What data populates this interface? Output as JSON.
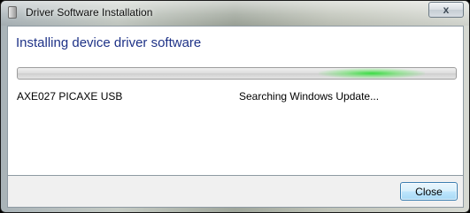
{
  "window": {
    "title": "Driver Software Installation",
    "close_glyph": "x"
  },
  "main": {
    "heading": "Installing device driver software",
    "progress": {
      "style": "indeterminate",
      "accent_color": "#2fd43a"
    },
    "device": {
      "name": "AXE027 PICAXE USB",
      "status": "Searching Windows Update..."
    }
  },
  "footer": {
    "close_label": "Close"
  },
  "icons": {
    "app": "driver-icon",
    "close": "close-icon"
  },
  "colors": {
    "heading": "#1e3287",
    "button_border": "#3c7fb1"
  }
}
